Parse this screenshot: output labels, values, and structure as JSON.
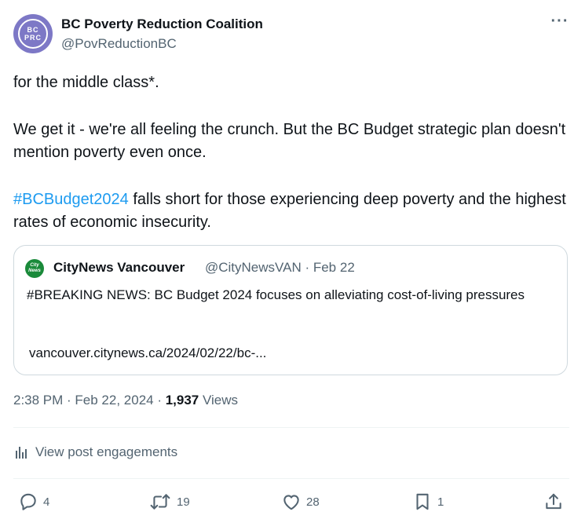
{
  "author": {
    "avatar_line1": "BC",
    "avatar_line2": "PRC",
    "name": "BC Poverty Reduction Coalition",
    "handle": "@PovReductionBC"
  },
  "more_label": "···",
  "tweet": {
    "line1": "for the middle class*.",
    "para2": "We get it - we're all feeling the crunch. But the BC Budget strategic plan doesn't mention poverty even once.",
    "hashtag": "#BCBudget2024",
    "para3_rest": " falls short for those experiencing deep poverty and the highest rates of economic insecurity."
  },
  "quote": {
    "avatar_line1": "City",
    "avatar_line2": "News",
    "name": "CityNews Vancouver",
    "meta": "@CityNewsVAN · Feb 22",
    "text": "#BREAKING NEWS: BC Budget 2024 focuses on alleviating cost-of-living pressures",
    "link": "vancouver.citynews.ca/2024/02/22/bc-..."
  },
  "timestamp": {
    "time_date": "2:38 PM · Feb 22, 2024 · ",
    "views_count": "1,937",
    "views_label": " Views"
  },
  "engagements_label": "View post engagements",
  "actions": {
    "replies": "4",
    "reposts": "19",
    "likes": "28",
    "bookmarks": "1"
  },
  "colors": {
    "link": "#1d9bf0",
    "muted": "#536471",
    "text": "#0f1419",
    "avatar": "#7d78c6",
    "quote_avatar": "#1a8a3a"
  }
}
